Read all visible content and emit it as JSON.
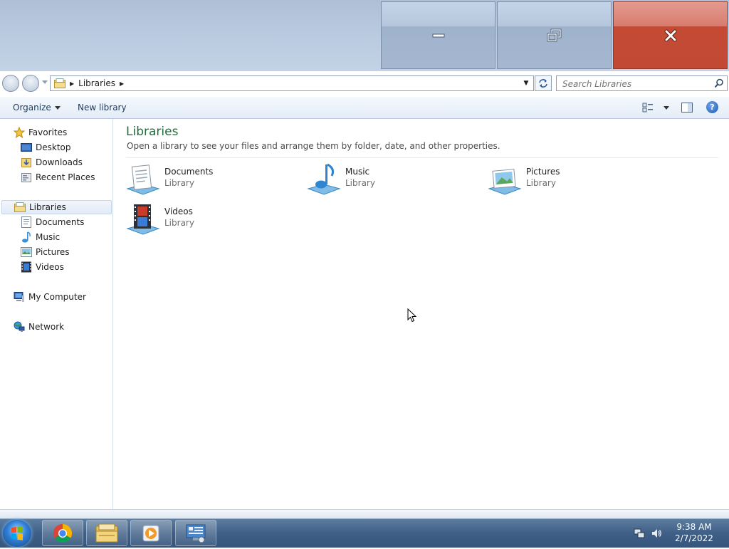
{
  "window": {
    "caption_buttons": {
      "minimize_icon": "minimize-icon",
      "restore_icon": "restore-icon",
      "close_icon": "close-icon"
    }
  },
  "address": {
    "crumbs": [
      "Libraries"
    ],
    "search_placeholder": "Search Libraries"
  },
  "toolbar": {
    "organize_label": "Organize",
    "new_library_label": "New library"
  },
  "nav": {
    "favorites": "Favorites",
    "desktop": "Desktop",
    "downloads": "Downloads",
    "recent_places": "Recent Places",
    "libraries": "Libraries",
    "documents": "Documents",
    "music": "Music",
    "pictures": "Pictures",
    "videos": "Videos",
    "my_computer": "My Computer",
    "network": "Network"
  },
  "content": {
    "title": "Libraries",
    "subtitle": "Open a library to see your files and arrange them by folder, date, and other properties.",
    "libraries": [
      {
        "name": "Documents",
        "type": "Library",
        "icon": "documents-library-icon"
      },
      {
        "name": "Music",
        "type": "Library",
        "icon": "music-library-icon"
      },
      {
        "name": "Pictures",
        "type": "Library",
        "icon": "pictures-library-icon"
      },
      {
        "name": "Videos",
        "type": "Library",
        "icon": "videos-library-icon"
      }
    ]
  },
  "taskbar": {
    "apps": [
      "start-orb-icon",
      "chrome-icon",
      "file-explorer-icon",
      "media-player-icon",
      "control-panel-icon"
    ],
    "clock_time": "9:38 AM",
    "clock_date": "2/7/2022"
  },
  "colors": {
    "title_green": "#1e6e3a",
    "close_red": "#c44a33",
    "taskbar": "#3f5f86"
  }
}
